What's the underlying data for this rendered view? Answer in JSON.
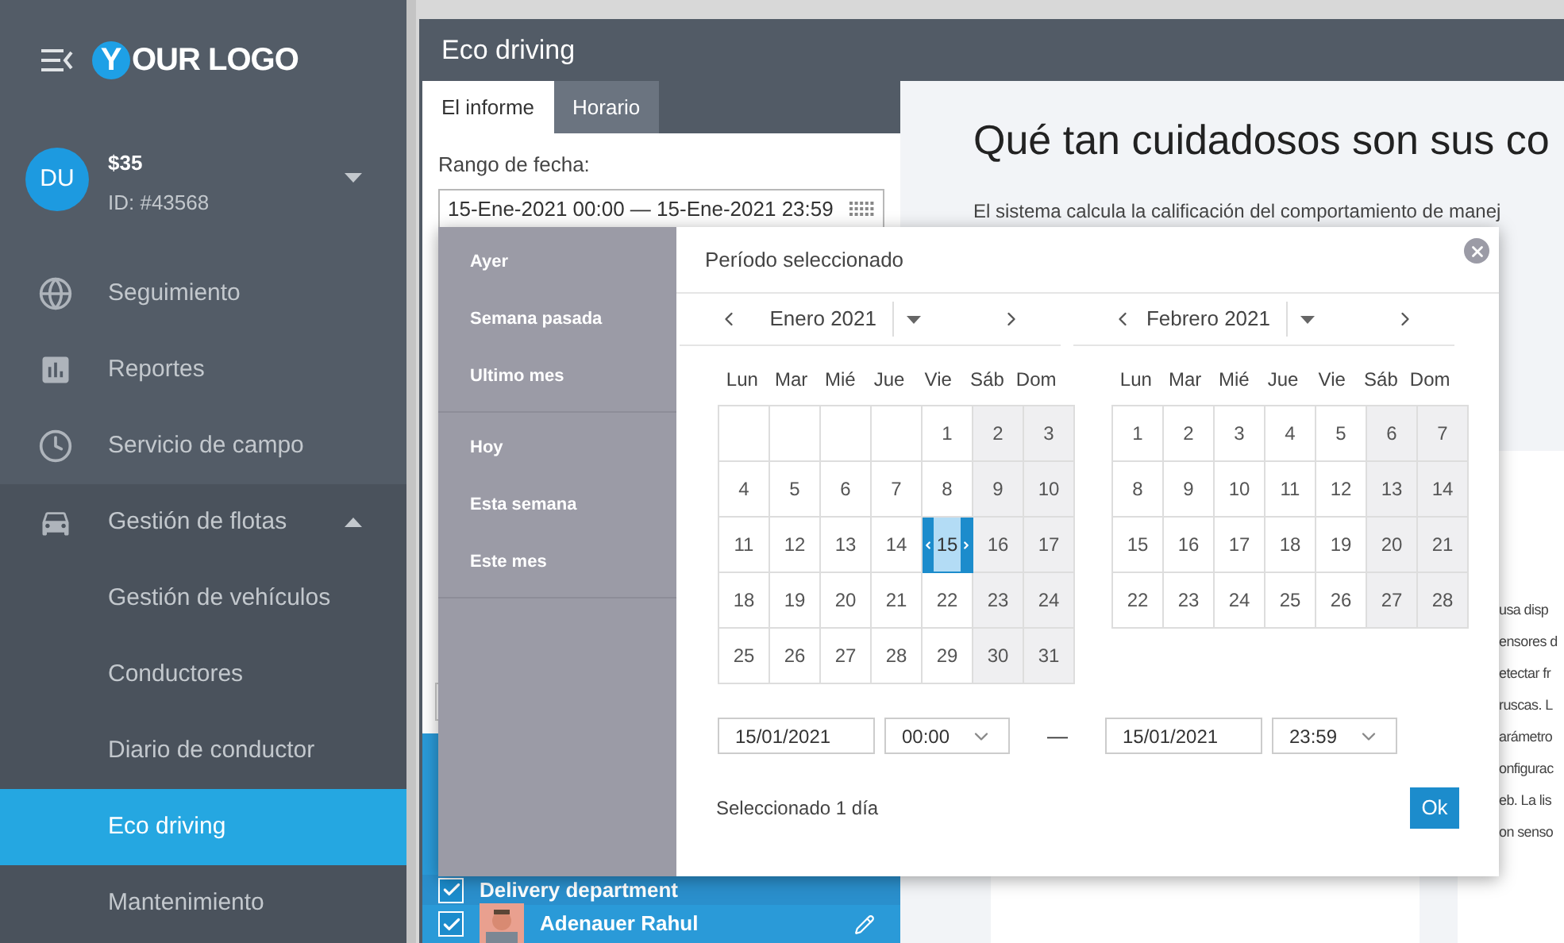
{
  "sidebar": {
    "logo": {
      "badge": "Y",
      "text": "OUR LOGO"
    },
    "user": {
      "initials": "DU",
      "balance": "$35",
      "id": "ID: #43568"
    },
    "items": [
      {
        "label": "Seguimiento",
        "selected": false
      },
      {
        "label": "Reportes",
        "selected": false
      },
      {
        "label": "Servicio de campo",
        "selected": false
      },
      {
        "label": "Gestión de flotas",
        "selected": false,
        "expanded": true,
        "children": [
          {
            "label": "Gestión de vehículos",
            "selected": false
          },
          {
            "label": "Conductores",
            "selected": false
          },
          {
            "label": "Diario de conductor",
            "selected": false
          },
          {
            "label": "Eco driving",
            "selected": true
          },
          {
            "label": "Mantenimiento",
            "selected": false
          }
        ]
      }
    ]
  },
  "window": {
    "title": "Eco driving"
  },
  "tabs": [
    {
      "label": "El informe",
      "selected": true
    },
    {
      "label": "Horario",
      "selected": false
    }
  ],
  "date_range": {
    "label": "Rango de fecha:",
    "value": "15-Ene-2021 00:00 — 15-Ene-2021 23:59"
  },
  "groups": [
    {
      "label": "Delivery department",
      "checked": true
    },
    {
      "label": "Adenauer Rahul",
      "checked": true
    }
  ],
  "content": {
    "heading": "Qué tan cuidadosos son sus co",
    "intro": [
      "El sistema calcula la calificación del comportamiento de manej"
    ],
    "side_text": [
      "usa disp",
      "ensores d",
      "etectar fr",
      "ruscas. L",
      "arámetro",
      "onfigurac",
      "eb. La lis",
      "on senso"
    ]
  },
  "date_picker": {
    "title": "Período seleccionado",
    "preset_groups": [
      [
        {
          "label": "Ayer",
          "selected": false
        },
        {
          "label": "Semana pasada",
          "selected": false
        },
        {
          "label": "Ultimo mes",
          "selected": false
        }
      ],
      [
        {
          "label": "Hoy",
          "selected": false
        },
        {
          "label": "Esta semana",
          "selected": false
        },
        {
          "label": "Este mes",
          "selected": false
        }
      ]
    ],
    "months": [
      {
        "title": "Enero 2021",
        "weekdays": [
          "Lun",
          "Mar",
          "Mié",
          "Jue",
          "Vie",
          "Sáb",
          "Dom"
        ],
        "weeks": [
          [
            {
              "day": "1",
              "selected": false
            },
            {
              "day": "2",
              "selected": false
            },
            {
              "day": "3",
              "selected": false
            }
          ],
          [
            {
              "day": "4",
              "selected": false
            },
            {
              "day": "5",
              "selected": false
            },
            {
              "day": "6",
              "selected": false
            },
            {
              "day": "7",
              "selected": false
            },
            {
              "day": "8",
              "selected": false
            },
            {
              "day": "9",
              "selected": false
            },
            {
              "day": "10",
              "selected": false
            }
          ],
          [
            {
              "day": "11",
              "selected": false
            },
            {
              "day": "12",
              "selected": false
            },
            {
              "day": "13",
              "selected": false
            },
            {
              "day": "14",
              "selected": false
            },
            {
              "day": "15",
              "selected": true
            },
            {
              "day": "16",
              "selected": false
            },
            {
              "day": "17",
              "selected": false
            }
          ],
          [
            {
              "day": "18",
              "selected": false
            },
            {
              "day": "19",
              "selected": false
            },
            {
              "day": "20",
              "selected": false
            },
            {
              "day": "21",
              "selected": false
            },
            {
              "day": "22",
              "selected": false
            },
            {
              "day": "23",
              "selected": false
            },
            {
              "day": "24",
              "selected": false
            }
          ],
          [
            {
              "day": "25",
              "selected": false
            },
            {
              "day": "26",
              "selected": false
            },
            {
              "day": "27",
              "selected": false
            },
            {
              "day": "28",
              "selected": false
            },
            {
              "day": "29",
              "selected": false
            },
            {
              "day": "30",
              "selected": false
            },
            {
              "day": "31",
              "selected": false
            }
          ]
        ]
      },
      {
        "title": "Febrero 2021",
        "weekdays": [
          "Lun",
          "Mar",
          "Mié",
          "Jue",
          "Vie",
          "Sáb",
          "Dom"
        ],
        "weeks": [
          [
            {
              "day": "1",
              "selected": false
            },
            {
              "day": "2",
              "selected": false
            },
            {
              "day": "3",
              "selected": false
            },
            {
              "day": "4",
              "selected": false
            },
            {
              "day": "5",
              "selected": false
            },
            {
              "day": "6",
              "selected": false
            },
            {
              "day": "7",
              "selected": false
            }
          ],
          [
            {
              "day": "8",
              "selected": false
            },
            {
              "day": "9",
              "selected": false
            },
            {
              "day": "10",
              "selected": false
            },
            {
              "day": "11",
              "selected": false
            },
            {
              "day": "12",
              "selected": false
            },
            {
              "day": "13",
              "selected": false
            },
            {
              "day": "14",
              "selected": false
            }
          ],
          [
            {
              "day": "15",
              "selected": false
            },
            {
              "day": "16",
              "selected": false
            },
            {
              "day": "17",
              "selected": false
            },
            {
              "day": "18",
              "selected": false
            },
            {
              "day": "19",
              "selected": false
            },
            {
              "day": "20",
              "selected": false
            },
            {
              "day": "21",
              "selected": false
            }
          ],
          [
            {
              "day": "22",
              "selected": false
            },
            {
              "day": "23",
              "selected": false
            },
            {
              "day": "24",
              "selected": false
            },
            {
              "day": "25",
              "selected": false
            },
            {
              "day": "26",
              "selected": false
            },
            {
              "day": "27",
              "selected": false
            },
            {
              "day": "28",
              "selected": false
            }
          ]
        ]
      }
    ],
    "from": {
      "date": "15/01/2021",
      "time": "00:00"
    },
    "separator": "—",
    "to": {
      "date": "15/01/2021",
      "time": "23:59"
    },
    "summary": "Seleccionado 1 día",
    "ok": "Ok"
  }
}
